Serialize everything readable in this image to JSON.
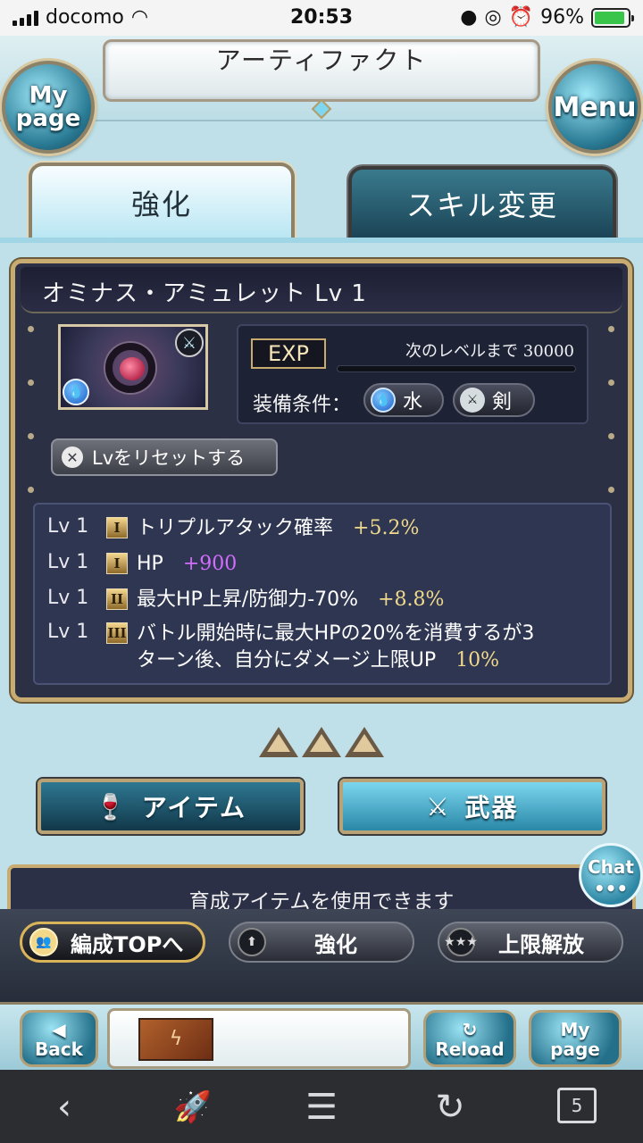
{
  "status_bar": {
    "carrier": "docomo",
    "time": "20:53",
    "battery": "96%"
  },
  "header": {
    "title": "アーティファクト",
    "mypage_line1": "My",
    "mypage_line2": "page",
    "menu": "Menu"
  },
  "tabs": [
    {
      "label": "強化",
      "active": true
    },
    {
      "label": "スキル変更",
      "active": false
    }
  ],
  "artifact": {
    "name": "オミナス・アミュレット Lv 1",
    "exp_label": "EXP",
    "next_level_text": "次のレベルまで 30000",
    "exp_progress": 0,
    "condition_label": "装備条件：",
    "element": "水",
    "weapon_type": "剣",
    "reset_label": "Lvをリセットする"
  },
  "skills": [
    {
      "lv": "Lv 1",
      "tier": "I",
      "name": "トリプルアタック確率",
      "value": "+5.2%",
      "value_color": "gold"
    },
    {
      "lv": "Lv 1",
      "tier": "I",
      "name": "HP",
      "value": "+900",
      "value_color": "purple"
    },
    {
      "lv": "Lv 1",
      "tier": "II",
      "name": "最大HP上昇/防御力-70%",
      "value": "+8.8%",
      "value_color": "gold"
    },
    {
      "lv": "Lv 1",
      "tier": "III",
      "name_line1": "バトル開始時に最大HPの20%を消費するが3",
      "name_line2": "ターン後、自分にダメージ上限UP",
      "value": "10%",
      "value_color": "gold"
    }
  ],
  "evolution_stars": 3,
  "buttons": {
    "item": "アイテム",
    "weapon": "武器"
  },
  "message": "育成アイテムを使用できます",
  "chat": "Chat",
  "toolbar": {
    "formation": "編成TOPへ",
    "enhance": "強化",
    "uncap": "上限解放"
  },
  "nav": {
    "back": "Back",
    "reload": "Reload",
    "mypage_line1": "My",
    "mypage_line2": "page"
  },
  "browser": {
    "tab_count": "5"
  },
  "colors": {
    "gold_text": "#f1d98c",
    "purple_text": "#d36cff",
    "frame_gold": "#c8ab70",
    "panel_bg": "#2b3045"
  }
}
